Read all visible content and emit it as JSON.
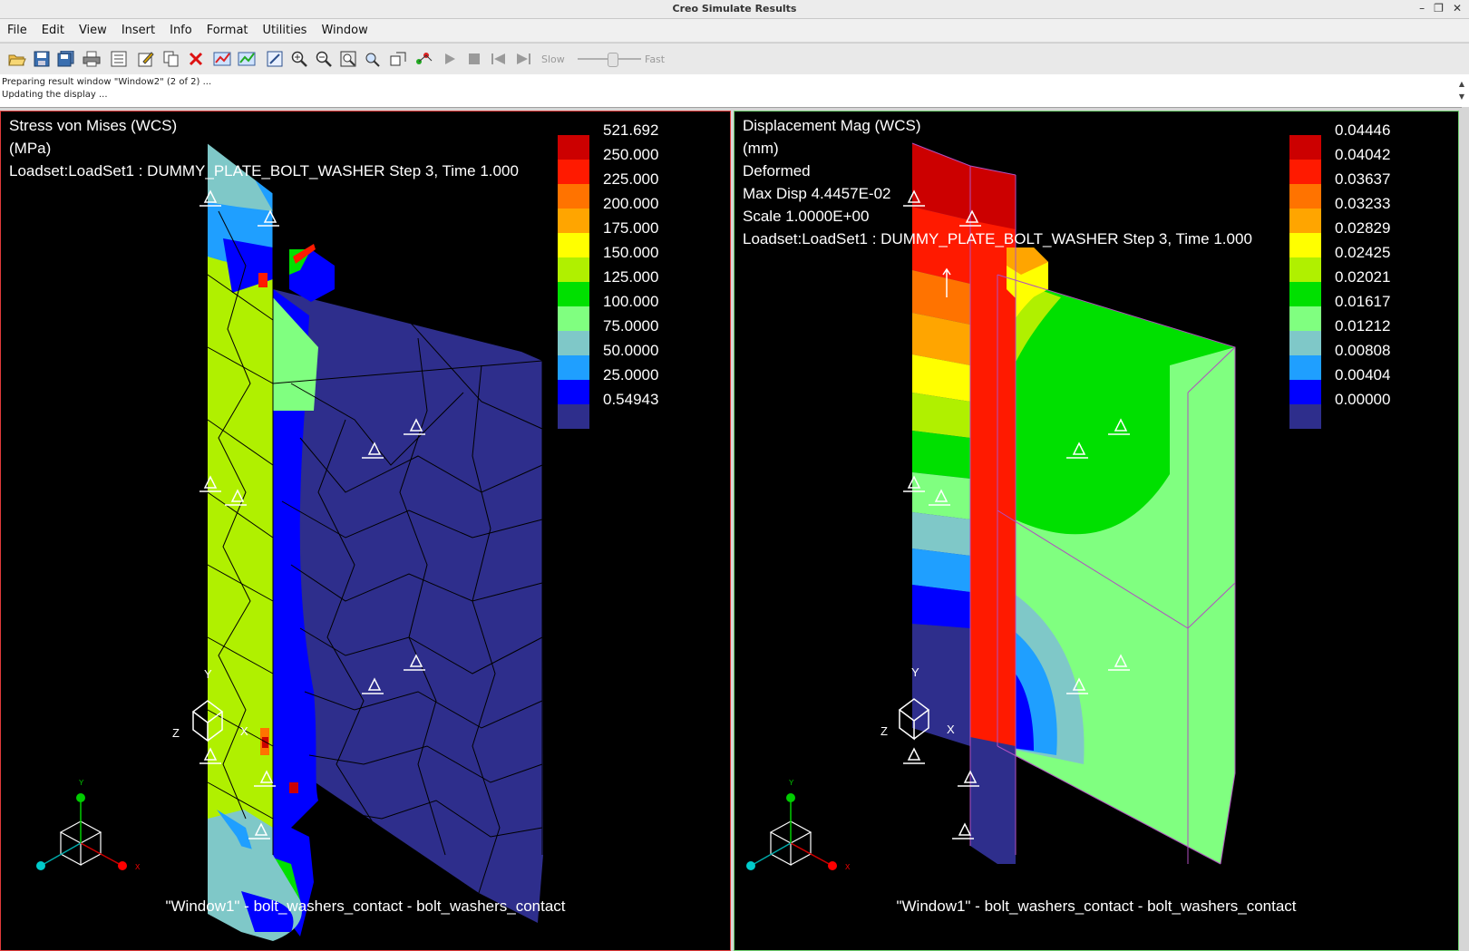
{
  "window": {
    "title": "Creo Simulate Results",
    "minimize_label": "–",
    "restore_label": "❐",
    "close_label": "✕"
  },
  "menu": [
    "File",
    "Edit",
    "View",
    "Insert",
    "Info",
    "Format",
    "Utilities",
    "Window"
  ],
  "toolbar": {
    "icons": [
      "open-icon",
      "save-icon",
      "save-all-icon",
      "print-icon",
      "properties-icon",
      "edit-icon",
      "copy-icon",
      "delete-icon",
      "results-icon",
      "results-window-icon",
      "refit-icon",
      "zoom-in-icon",
      "zoom-out-icon",
      "zoom-window-icon",
      "pan-icon",
      "view-orient-icon",
      "query-icon",
      "play-icon",
      "stop-icon",
      "rewind-icon",
      "step-icon"
    ],
    "slow_label": "Slow",
    "fast_label": "Fast",
    "speed": 0.5
  },
  "status": {
    "line1": "Preparing result window \"Window2\" (2 of 2) ...",
    "line2": "Updating the display ..."
  },
  "windows": [
    {
      "title_lines": [
        "Stress von Mises (WCS)",
        "(MPa)",
        "Loadset:LoadSet1 :  DUMMY_PLATE_BOLT_WASHER Step 3, Time  1.000"
      ],
      "legend_values": [
        "521.692",
        "250.000",
        "225.000",
        "200.000",
        "175.000",
        "150.000",
        "125.000",
        "100.000",
        "75.0000",
        "50.0000",
        "25.0000",
        "0.54943"
      ],
      "legend_colors": [
        "#cc0000",
        "#ff1a00",
        "#ff7300",
        "#ffa500",
        "#ffff00",
        "#b0f000",
        "#00e000",
        "#80ff80",
        "#7fc8c8",
        "#1f9fff",
        "#0000ff",
        "#2e2e8c"
      ],
      "footer": "\"Window1\" - bolt_washers_contact - bolt_washers_contact",
      "triad": {
        "x": "X",
        "y": "Y",
        "z": "Z"
      }
    },
    {
      "title_lines": [
        "Displacement Mag (WCS)",
        "(mm)",
        "Deformed",
        "Max Disp  4.4457E-02",
        "Scale  1.0000E+00",
        "Loadset:LoadSet1 :  DUMMY_PLATE_BOLT_WASHER Step 3, Time  1.000"
      ],
      "legend_values": [
        "0.04446",
        "0.04042",
        "0.03637",
        "0.03233",
        "0.02829",
        "0.02425",
        "0.02021",
        "0.01617",
        "0.01212",
        "0.00808",
        "0.00404",
        "0.00000"
      ],
      "legend_colors": [
        "#cc0000",
        "#ff1a00",
        "#ff7300",
        "#ffa500",
        "#ffff00",
        "#b0f000",
        "#00e000",
        "#80ff80",
        "#7fc8c8",
        "#1f9fff",
        "#0000ff",
        "#2e2e8c"
      ],
      "footer": "\"Window1\" - bolt_washers_contact - bolt_washers_contact",
      "triad": {
        "x": "X",
        "y": "Y",
        "z": "Z"
      }
    }
  ]
}
